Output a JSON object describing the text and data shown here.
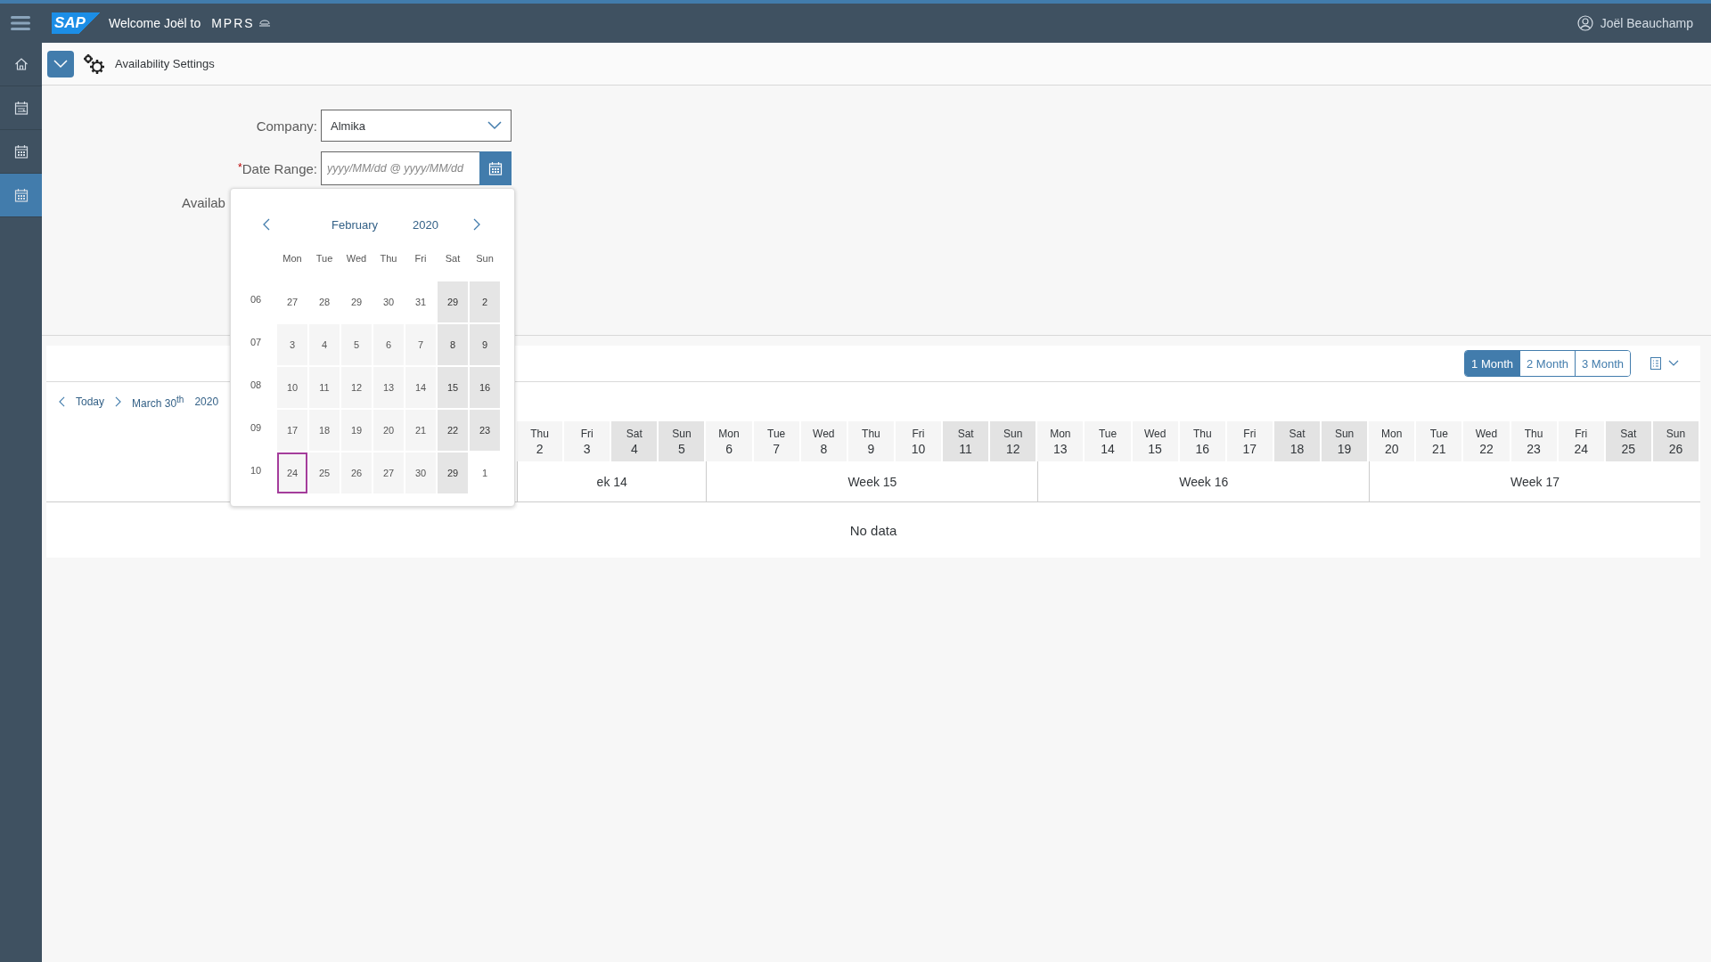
{
  "shell": {
    "logo": "SAP",
    "greeting": "Welcome Joël to",
    "product": "MPRS",
    "user": "Joël Beauchamp"
  },
  "sidebar": {
    "items": [
      {
        "kind": "home",
        "selected": false
      },
      {
        "kind": "calendar-edit",
        "selected": false
      },
      {
        "kind": "calendar",
        "selected": false
      },
      {
        "kind": "calendar",
        "selected": true
      }
    ]
  },
  "page": {
    "title": "Availability Settings"
  },
  "form": {
    "company": {
      "label": "Company:",
      "value": "Almika"
    },
    "date_range": {
      "required_mark": "*",
      "label": "Date Range:",
      "placeholder": "yyyy/MM/dd @ yyyy/MM/dd"
    },
    "availability": {
      "label": "Availab"
    }
  },
  "date_picker": {
    "month": "February",
    "year": "2020",
    "weekdays": [
      "Mon",
      "Tue",
      "Wed",
      "Thu",
      "Fri",
      "Sat",
      "Sun"
    ],
    "weeks": [
      {
        "number": "06",
        "days": [
          {
            "day": "27",
            "kind": "plain",
            "selected": false
          },
          {
            "day": "28",
            "kind": "plain",
            "selected": false
          },
          {
            "day": "29",
            "kind": "plain",
            "selected": false
          },
          {
            "day": "30",
            "kind": "plain",
            "selected": false
          },
          {
            "day": "31",
            "kind": "plain",
            "selected": false
          },
          {
            "day": "29",
            "kind": "weekend",
            "selected": false
          },
          {
            "day": "2",
            "kind": "weekend",
            "selected": false
          }
        ]
      },
      {
        "number": "07",
        "days": [
          {
            "day": "3",
            "kind": "weekday",
            "selected": false
          },
          {
            "day": "4",
            "kind": "weekday",
            "selected": false
          },
          {
            "day": "5",
            "kind": "weekday",
            "selected": false
          },
          {
            "day": "6",
            "kind": "weekday",
            "selected": false
          },
          {
            "day": "7",
            "kind": "weekday",
            "selected": false
          },
          {
            "day": "8",
            "kind": "weekend",
            "selected": false
          },
          {
            "day": "9",
            "kind": "weekend",
            "selected": false
          }
        ]
      },
      {
        "number": "08",
        "days": [
          {
            "day": "10",
            "kind": "weekday",
            "selected": false
          },
          {
            "day": "11",
            "kind": "weekday",
            "selected": false
          },
          {
            "day": "12",
            "kind": "weekday",
            "selected": false
          },
          {
            "day": "13",
            "kind": "weekday",
            "selected": false
          },
          {
            "day": "14",
            "kind": "weekday",
            "selected": false
          },
          {
            "day": "15",
            "kind": "weekend",
            "selected": false
          },
          {
            "day": "16",
            "kind": "weekend",
            "selected": false
          }
        ]
      },
      {
        "number": "09",
        "days": [
          {
            "day": "17",
            "kind": "weekday",
            "selected": false
          },
          {
            "day": "18",
            "kind": "weekday",
            "selected": false
          },
          {
            "day": "19",
            "kind": "weekday",
            "selected": false
          },
          {
            "day": "20",
            "kind": "weekday",
            "selected": false
          },
          {
            "day": "21",
            "kind": "weekday",
            "selected": false
          },
          {
            "day": "22",
            "kind": "weekend",
            "selected": false
          },
          {
            "day": "23",
            "kind": "weekend",
            "selected": false
          }
        ]
      },
      {
        "number": "10",
        "days": [
          {
            "day": "24",
            "kind": "weekday",
            "selected": true
          },
          {
            "day": "25",
            "kind": "weekday",
            "selected": false
          },
          {
            "day": "26",
            "kind": "weekday",
            "selected": false
          },
          {
            "day": "27",
            "kind": "weekday",
            "selected": false
          },
          {
            "day": "30",
            "kind": "weekday",
            "selected": false
          },
          {
            "day": "29",
            "kind": "weekend",
            "selected": false
          },
          {
            "day": "1",
            "kind": "plain",
            "selected": false
          }
        ]
      }
    ]
  },
  "timeline": {
    "ranges": [
      {
        "label": "1 Month",
        "selected": true
      },
      {
        "label": "2 Month",
        "selected": false
      },
      {
        "label": "3 Month",
        "selected": false
      }
    ],
    "nav": {
      "today": "Today",
      "date": "March 30$^{th}$",
      "year": "2020"
    },
    "weeks": [
      {
        "label": "ek 14",
        "days": [
          {
            "weekday": "Thu",
            "day": "2",
            "weekend": false
          },
          {
            "weekday": "Fri",
            "day": "3",
            "weekend": false
          },
          {
            "weekday": "Sat",
            "day": "4",
            "weekend": true
          },
          {
            "weekday": "Sun",
            "day": "5",
            "weekend": true
          }
        ]
      },
      {
        "label": "Week 15",
        "days": [
          {
            "weekday": "Mon",
            "day": "6",
            "weekend": false
          },
          {
            "weekday": "Tue",
            "day": "7",
            "weekend": false
          },
          {
            "weekday": "Wed",
            "day": "8",
            "weekend": false
          },
          {
            "weekday": "Thu",
            "day": "9",
            "weekend": false
          },
          {
            "weekday": "Fri",
            "day": "10",
            "weekend": false
          },
          {
            "weekday": "Sat",
            "day": "11",
            "weekend": true
          },
          {
            "weekday": "Sun",
            "day": "12",
            "weekend": true
          }
        ]
      },
      {
        "label": "Week 16",
        "days": [
          {
            "weekday": "Mon",
            "day": "13",
            "weekend": false
          },
          {
            "weekday": "Tue",
            "day": "14",
            "weekend": false
          },
          {
            "weekday": "Wed",
            "day": "15",
            "weekend": false
          },
          {
            "weekday": "Thu",
            "day": "16",
            "weekend": false
          },
          {
            "weekday": "Fri",
            "day": "17",
            "weekend": false
          },
          {
            "weekday": "Sat",
            "day": "18",
            "weekend": true
          },
          {
            "weekday": "Sun",
            "day": "19",
            "weekend": true
          }
        ]
      },
      {
        "label": "Week 17",
        "days": [
          {
            "weekday": "Mon",
            "day": "20",
            "weekend": false
          },
          {
            "weekday": "Tue",
            "day": "21",
            "weekend": false
          },
          {
            "weekday": "Wed",
            "day": "22",
            "weekend": false
          },
          {
            "weekday": "Thu",
            "day": "23",
            "weekend": false
          },
          {
            "weekday": "Fri",
            "day": "24",
            "weekend": false
          },
          {
            "weekday": "Sat",
            "day": "25",
            "weekend": true
          },
          {
            "weekday": "Sun",
            "day": "26",
            "weekend": true
          }
        ]
      }
    ],
    "empty": "No data"
  }
}
